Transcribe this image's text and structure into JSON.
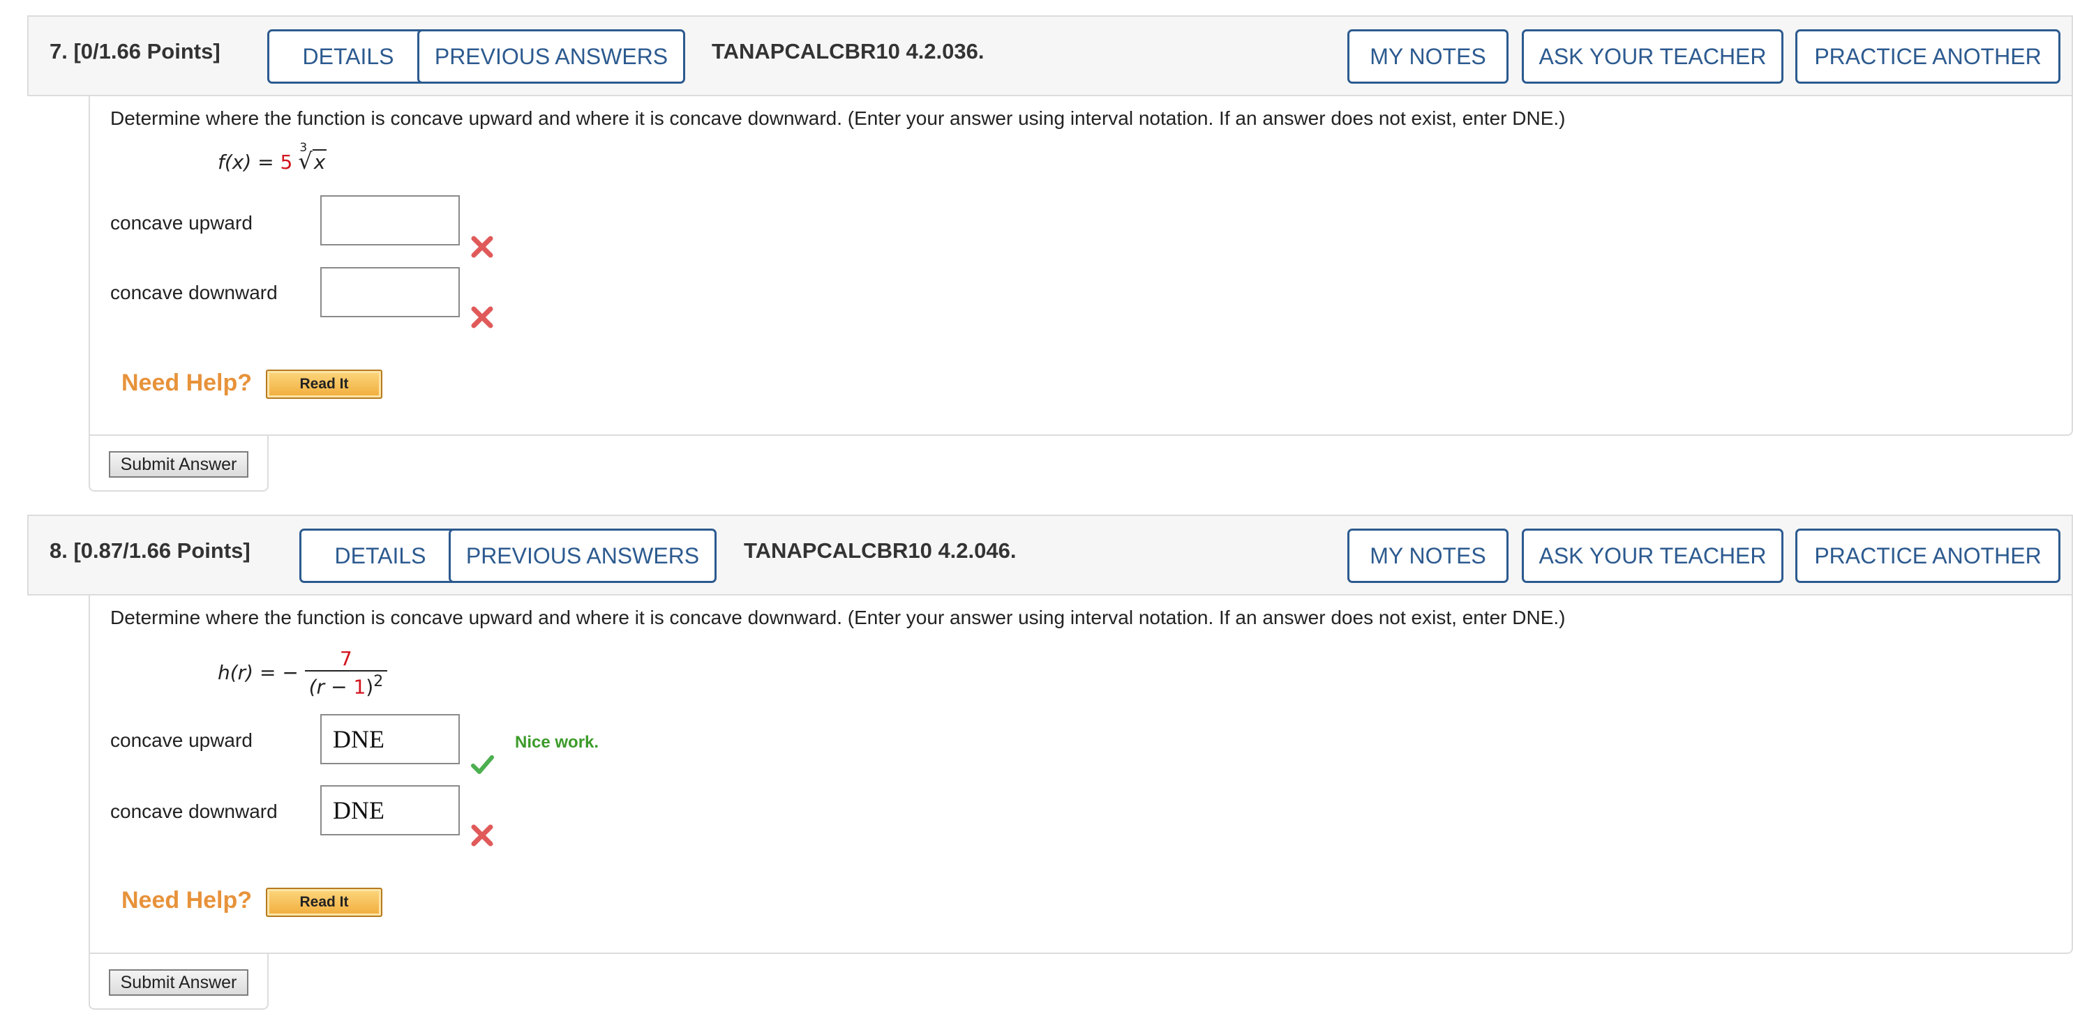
{
  "questions": [
    {
      "points": "7.  [0/1.66 Points]",
      "code": "TANAPCALCBR10 4.2.036.",
      "buttons": {
        "details": "DETAILS",
        "previous_answers": "PREVIOUS ANSWERS",
        "my_notes": "MY NOTES",
        "ask_teacher": "ASK YOUR TEACHER",
        "practice_another": "PRACTICE ANOTHER"
      },
      "instructions": "Determine where the function is concave upward and where it is concave downward. (Enter your answer using interval notation. If an answer does not exist, enter DNE.)",
      "formula": {
        "lhs": "f(x) = ",
        "coef": "5",
        "index": "3",
        "radicand": "x"
      },
      "rows": [
        {
          "label": "concave upward",
          "value": "",
          "status": "incorrect"
        },
        {
          "label": "concave downward",
          "value": "",
          "status": "incorrect"
        }
      ],
      "need_help": "Need Help?",
      "read_it": "Read It",
      "submit": "Submit Answer"
    },
    {
      "points": "8.  [0.87/1.66 Points]",
      "code": "TANAPCALCBR10 4.2.046.",
      "buttons": {
        "details": "DETAILS",
        "previous_answers": "PREVIOUS ANSWERS",
        "my_notes": "MY NOTES",
        "ask_teacher": "ASK YOUR TEACHER",
        "practice_another": "PRACTICE ANOTHER"
      },
      "instructions": "Determine where the function is concave upward and where it is concave downward. (Enter your answer using interval notation. If an answer does not exist, enter DNE.)",
      "formula": {
        "lhs": "h(r) = −",
        "numerator": "7",
        "den_open": "(r − ",
        "den_num": "1",
        "den_close": ")",
        "exponent": "2"
      },
      "rows": [
        {
          "label": "concave upward",
          "value": "DNE",
          "status": "correct",
          "feedback": "Nice work."
        },
        {
          "label": "concave downward",
          "value": "DNE",
          "status": "incorrect"
        }
      ],
      "need_help": "Need Help?",
      "read_it": "Read It",
      "submit": "Submit Answer"
    }
  ],
  "colors": {
    "accent_blue": "#2c5a8f",
    "incorrect_red": "#e05a5a",
    "correct_green": "#4caf50",
    "need_help_orange": "#e7923a",
    "formula_red": "#d2141e"
  },
  "icons": {
    "incorrect": "x-mark-icon",
    "correct": "check-mark-icon"
  }
}
